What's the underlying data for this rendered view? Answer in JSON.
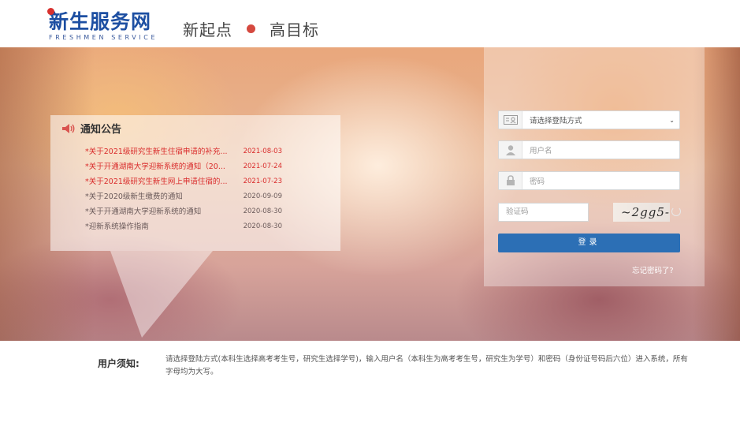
{
  "header": {
    "logo_text": "新生服务网",
    "logo_subtitle": "FRESHMEN SERVICE",
    "slogan_left": "新起点",
    "slogan_right": "高目标"
  },
  "notices": {
    "title": "通知公告",
    "items": [
      {
        "title": "*关于2021级研究生新生住宿申请的补充...",
        "date": "2021-08-03"
      },
      {
        "title": "*关于开通湖南大学迎新系统的通知（20...",
        "date": "2021-07-24"
      },
      {
        "title": "*关于2021级研究生新生网上申请住宿的...",
        "date": "2021-07-23"
      },
      {
        "title": "*关于2020级新生缴费的通知",
        "date": "2020-09-09"
      },
      {
        "title": "*关于开通湖南大学迎新系统的通知",
        "date": "2020-08-30"
      },
      {
        "title": "*迎新系统操作指南",
        "date": "2020-08-30"
      }
    ]
  },
  "login": {
    "method_select": "请选择登陆方式",
    "username_placeholder": "用户名",
    "password_placeholder": "密码",
    "captcha_placeholder": "验证码",
    "captcha_text": "~2gg5-",
    "login_label": "登录",
    "forgot_label": "忘记密码了?"
  },
  "footer": {
    "label": "用户须知:",
    "text": "请选择登陆方式(本科生选择高考考生号，研究生选择学号)，输入用户名（本科生为高考考生号，研究生为学号）和密码（身份证号码后六位）进入系统，所有字母均为大写。"
  },
  "colors": {
    "brand_blue": "#1d4fa2",
    "accent_red": "#d92b2b",
    "button_blue": "#2c6fb5"
  }
}
